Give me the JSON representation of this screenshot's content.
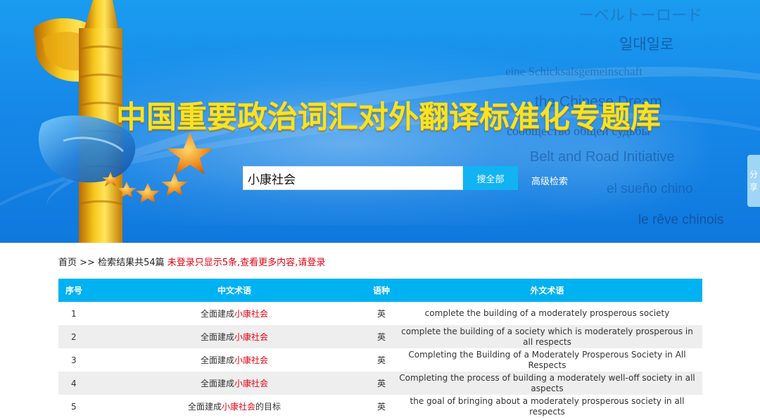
{
  "banner": {
    "site_title": "中国重要政治词汇对外翻译标准化专题库",
    "phrases": [
      "ーベルトーロード",
      "일대일로",
      "eine Schicksalsgemeinschaft",
      "the Chinese Dream",
      "сообщество общей судьбы",
      "Belt and Road Initiative",
      "el sueño chino",
      "le rêve chinois"
    ]
  },
  "search": {
    "value": "小康社会",
    "button_label": "搜全部",
    "advanced_label": "高级检索"
  },
  "share_tab": {
    "label": "分享"
  },
  "breadcrumb": {
    "home": "首页",
    "separator": ">>",
    "result_text": "检索结果共54篇",
    "login_notice": "未登录只显示5条,查看更多内容,请登录"
  },
  "table": {
    "headers": {
      "no": "序号",
      "cn": "中文术语",
      "lang": "语种",
      "en": "外文术语"
    },
    "rows": [
      {
        "no": "1",
        "cn_prefix": "全面建成",
        "cn_highlight": "小康社会",
        "cn_suffix": "",
        "lang": "英",
        "en": "complete the building of a moderately prosperous society"
      },
      {
        "no": "2",
        "cn_prefix": "全面建成",
        "cn_highlight": "小康社会",
        "cn_suffix": "",
        "lang": "英",
        "en": "complete the building of a society which is moderately prosperous in all respects"
      },
      {
        "no": "3",
        "cn_prefix": "全面建成",
        "cn_highlight": "小康社会",
        "cn_suffix": "",
        "lang": "英",
        "en": "Completing the Building of a Moderately Prosperous Society in All Respects"
      },
      {
        "no": "4",
        "cn_prefix": "全面建成",
        "cn_highlight": "小康社会",
        "cn_suffix": "",
        "lang": "英",
        "en": "Completing the process of building a moderately well-off society in all aspects"
      },
      {
        "no": "5",
        "cn_prefix": "全面建成",
        "cn_highlight": "小康社会",
        "cn_suffix": "的目标",
        "lang": "英",
        "en": "the goal of bringing about a moderately prosperous society in all respects"
      }
    ]
  },
  "colors": {
    "banner_blue": "#1688e8",
    "title_yellow": "#f8e321",
    "button_cyan": "#12b3f3",
    "header_cyan": "#00b2f2",
    "highlight_red": "#e60012"
  }
}
